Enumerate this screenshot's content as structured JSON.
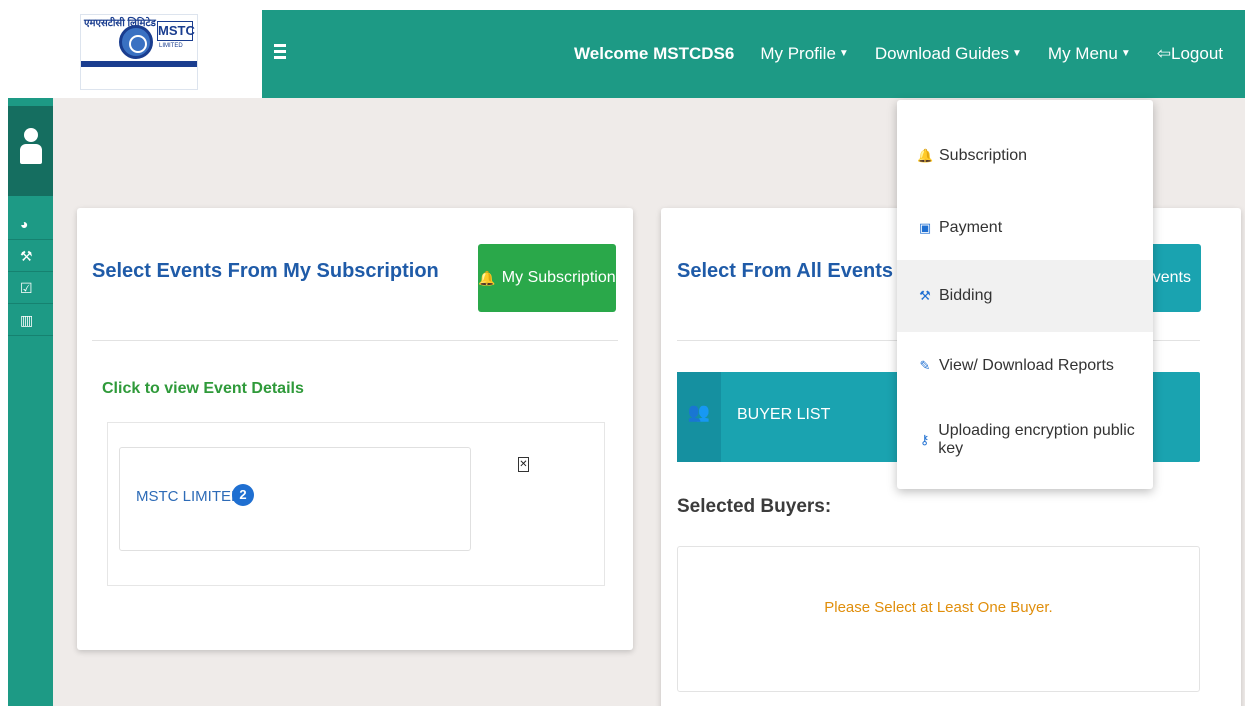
{
  "header": {
    "logo": {
      "hindi_text": "एमएसटीसी लिमिटेड",
      "brand": "MSTC",
      "sub": "LIMITED"
    },
    "welcome": "Welcome MSTCDS6",
    "nav": [
      {
        "label": "My Profile",
        "has_caret": true
      },
      {
        "label": "Download Guides",
        "has_caret": true
      },
      {
        "label": "My Menu",
        "has_caret": true
      },
      {
        "label": "Logout",
        "has_caret": false
      }
    ]
  },
  "sidebar": {
    "items": [
      {
        "icon": "dashboard-icon",
        "glyph": "◕"
      },
      {
        "icon": "gavel-icon",
        "glyph": "⚒"
      },
      {
        "icon": "checkbox-icon",
        "glyph": "☑"
      },
      {
        "icon": "chart-icon",
        "glyph": "▥"
      }
    ]
  },
  "left_panel": {
    "title": "Select Events From My Subscription",
    "subscription_button": "My Subscription",
    "click_label": "Click to view Event Details",
    "event": {
      "name": "MSTC LIMITED",
      "count": "2"
    }
  },
  "right_panel": {
    "title": "Select From All Events",
    "all_events_button": "Events",
    "buyer_list_label": "BUYER LIST",
    "selected_buyers_label": "Selected Buyers:",
    "warning": "Please Select at Least One Buyer."
  },
  "dropdown": {
    "items": [
      {
        "label": "Subscription",
        "icon": "bell-icon",
        "glyph": "🔔"
      },
      {
        "label": "Payment",
        "icon": "payment-icon",
        "glyph": "▣"
      },
      {
        "label": "Bidding",
        "icon": "gavel-icon",
        "glyph": "⚒"
      },
      {
        "label": "View/ Download Reports",
        "icon": "edit-icon",
        "glyph": "✎"
      },
      {
        "label": "Uploading encryption public key",
        "icon": "key-icon",
        "glyph": "⚷"
      }
    ]
  },
  "colors": {
    "primary": "#1d9a85",
    "subscription_button": "#2aa84a",
    "info": "#1aa3b0",
    "title_blue": "#1f5ba8",
    "warning": "#e08e0b"
  }
}
